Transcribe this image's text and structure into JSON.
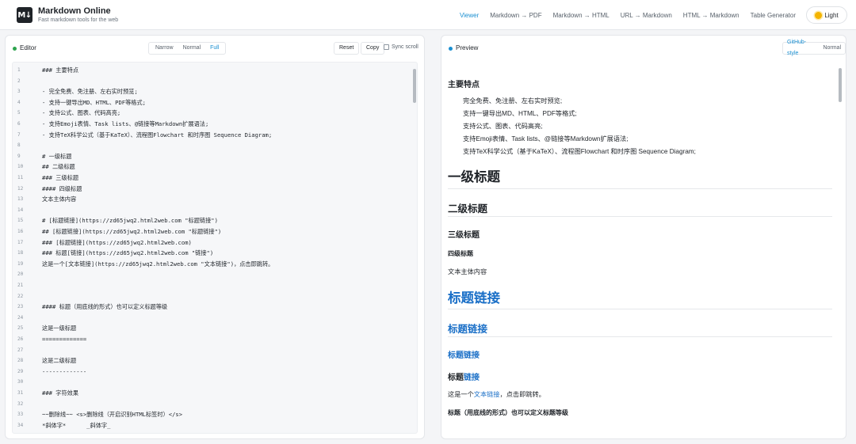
{
  "header": {
    "logo_text": "M↓",
    "title": "Markdown Online",
    "subtitle": "Fast markdown tools for the web",
    "nav": [
      {
        "label": "Viewer",
        "active": true
      },
      {
        "label": "Markdown → PDF",
        "active": false
      },
      {
        "label": "Markdown → HTML",
        "active": false
      },
      {
        "label": "URL → Markdown",
        "active": false
      },
      {
        "label": "HTML → Markdown",
        "active": false
      },
      {
        "label": "Table Generator",
        "active": false
      }
    ],
    "theme_label": "Light"
  },
  "editor": {
    "title": "Editor",
    "width_modes": [
      "Narrow",
      "Normal",
      "Full"
    ],
    "active_width_mode": "Full",
    "reset_label": "Reset",
    "copy_label": "Copy",
    "sync_scroll_label": "Sync scroll",
    "sync_scroll_checked": false,
    "lines": [
      "### 主要特点",
      "",
      "- 完全免费、免注册、左右实时预览;",
      "- 支持一键导出MD、HTML、PDF等格式;",
      "- 支持公式、图表、代码高亮;",
      "- 支持Emoji表情、Task lists、@链接等Markdown扩展语法;",
      "- 支持TeX科学公式（基于KaTeX）、流程图Flowchart 和时序图 Sequence Diagram;",
      "",
      "# 一级标题",
      "## 二级标题",
      "### 三级标题",
      "#### 四级标题",
      "文本主体内容",
      "",
      "# [标题链接](https://zd65jwq2.html2web.com \"标题链接\")",
      "## [标题链接](https://zd65jwq2.html2web.com \"标题链接\")",
      "### [标题链接](https://zd65jwq2.html2web.com)",
      "### 标题[链接](https://zd65jwq2.html2web.com \"链接\")",
      "这是一个[文本链接](https://zd65jwq2.html2web.com \"文本链接\")，点击即跳转。",
      "",
      "",
      "",
      "#### 标题（用底线的形式）也可以定义标题等级",
      "",
      "这是一级标题",
      "=============",
      "",
      "这是二级标题",
      "-------------",
      "",
      "### 字符效果",
      "",
      "~~删除线~~ <s>删除线（开启识别HTML标签时）</s>",
      "*斜体字*      _斜体字_"
    ]
  },
  "preview": {
    "title": "Preview",
    "style_modes": [
      "GitHub-style",
      "Normal"
    ],
    "active_style_mode": "GitHub-style",
    "features_heading": "主要特点",
    "features": [
      "完全免费、免注册、左右实时预览;",
      "支持一键导出MD、HTML、PDF等格式;",
      "支持公式、图表、代码高亮;",
      "支持Emoji表情、Task lists、@链接等Markdown扩展语法;",
      "支持TeX科学公式（基于KaTeX）、流程图Flowchart 和时序图 Sequence Diagram;"
    ],
    "h1": "一级标题",
    "h2": "二级标题",
    "h3": "三级标题",
    "h4": "四级标题",
    "body_text": "文本主体内容",
    "link_h1": "标题链接",
    "link_h2": "标题链接",
    "link_h3": "标题链接",
    "mixed_h3_prefix": "标题",
    "mixed_h3_link": "链接",
    "text_link_prefix": "这是一个",
    "text_link": "文本链接",
    "text_link_suffix": "，点击即跳转。",
    "underline_heading_h4": "标题（用底线的形式）也可以定义标题等级"
  },
  "colors": {
    "accent": "#1a8fd1",
    "link": "#1a6fc7",
    "editor_dot": "#2da44e"
  }
}
